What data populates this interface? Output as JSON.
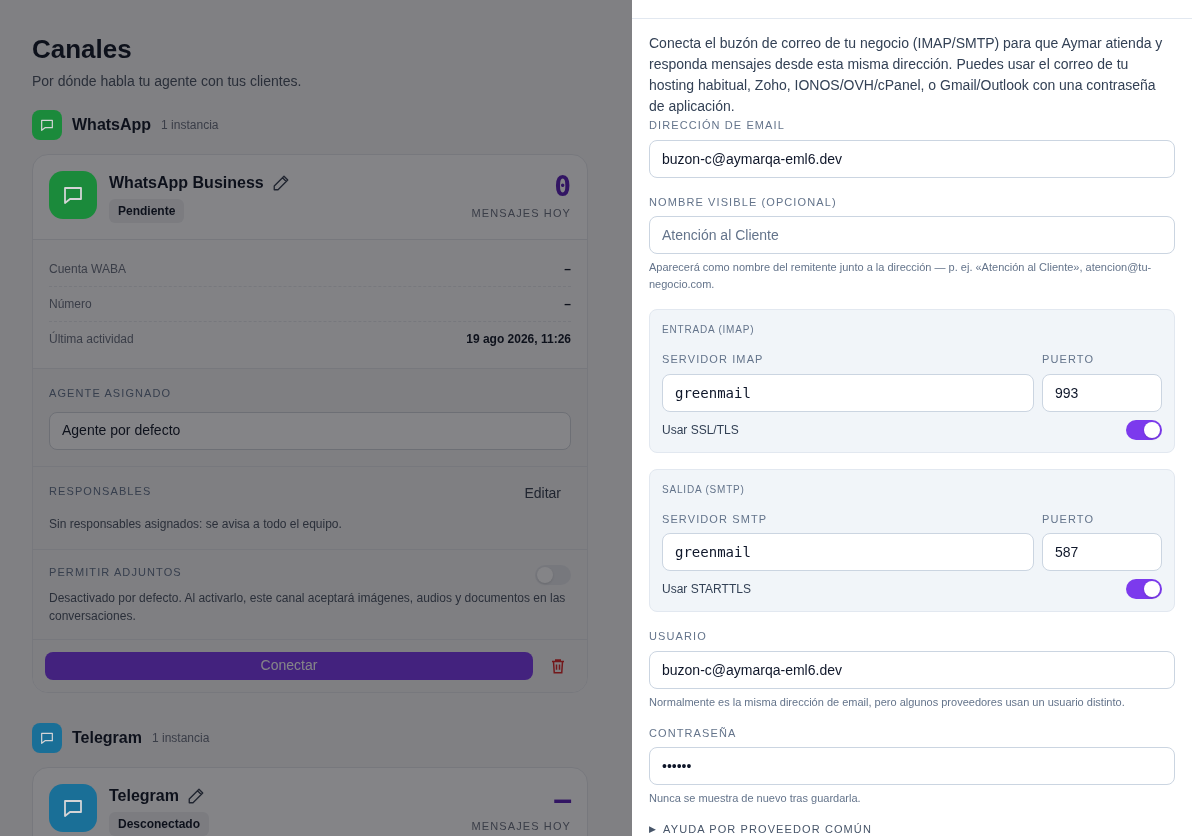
{
  "page": {
    "title": "Canales",
    "subtitle": "Por dónde habla tu agente con tus clientes."
  },
  "channels": [
    {
      "name": "WhatsApp",
      "count": "1 instancia",
      "color": "#1b8a3b",
      "card": {
        "name": "WhatsApp Business",
        "status": "Pendiente",
        "metric": "0",
        "metric_label": "MENSAJES HOY",
        "details": [
          {
            "label": "Cuenta WABA",
            "value": "–"
          },
          {
            "label": "Número",
            "value": "–"
          },
          {
            "label": "Última actividad",
            "value": "19 ago 2026, 11:26"
          }
        ],
        "agent_label": "AGENTE ASIGNADO",
        "agent": "Agente por defecto",
        "owners_label": "RESPONSABLES",
        "owners_edit": "Editar",
        "owners_text": "Sin responsables asignados: se avisa a todo el equipo.",
        "attach_label": "PERMITIR ADJUNTOS",
        "attach_on": false,
        "attach_text": "Desactivado por defecto. Al activarlo, este canal aceptará imágenes, audios y documentos en las conversaciones.",
        "connect": "Conectar"
      }
    },
    {
      "name": "Telegram",
      "count": "1 instancia",
      "color": "#1a6f97",
      "card": {
        "name": "Telegram",
        "status": "Desconectado",
        "metric": "—",
        "metric_label": "MENSAJES HOY"
      }
    }
  ],
  "drawer": {
    "intro": "Conecta el buzón de correo de tu negocio (IMAP/SMTP) para que Aymar atienda y responda mensajes desde esta misma dirección. Puedes usar el correo de tu hosting habitual, Zoho, IONOS/OVH/cPanel, o Gmail/Outlook con una contraseña de aplicación.",
    "email": {
      "label": "DIRECCIÓN DE EMAIL",
      "value": "buzon-c@aymarqa-eml6.dev"
    },
    "display_name": {
      "label": "NOMBRE VISIBLE (OPCIONAL)",
      "placeholder": "Atención al Cliente",
      "hint": "Aparecerá como nombre del remitente junto a la dirección — p. ej. «Atención al Cliente», atencion@tu-negocio.com."
    },
    "servers": [
      {
        "title": "ENTRADA (IMAP)",
        "server_label": "SERVIDOR IMAP",
        "server": "greenmail",
        "port_label": "PUERTO",
        "port": "993",
        "tls_label": "Usar SSL/TLS",
        "tls_on": true
      },
      {
        "title": "SALIDA (SMTP)",
        "server_label": "SERVIDOR SMTP",
        "server": "greenmail",
        "port_label": "PUERTO",
        "port": "587",
        "tls_label": "Usar STARTTLS",
        "tls_on": true
      }
    ],
    "user": {
      "label": "USUARIO",
      "value": "buzon-c@aymarqa-eml6.dev",
      "hint": "Normalmente es la misma dirección de email, pero algunos proveedores usan un usuario distinto."
    },
    "password": {
      "label": "CONTRASEÑA",
      "value": "••••••",
      "hint": "Nunca se muestra de nuevo tras guardarla."
    },
    "help": {
      "marker": "▶",
      "label": "AYUDA POR PROVEEDOR COMÚN"
    }
  }
}
